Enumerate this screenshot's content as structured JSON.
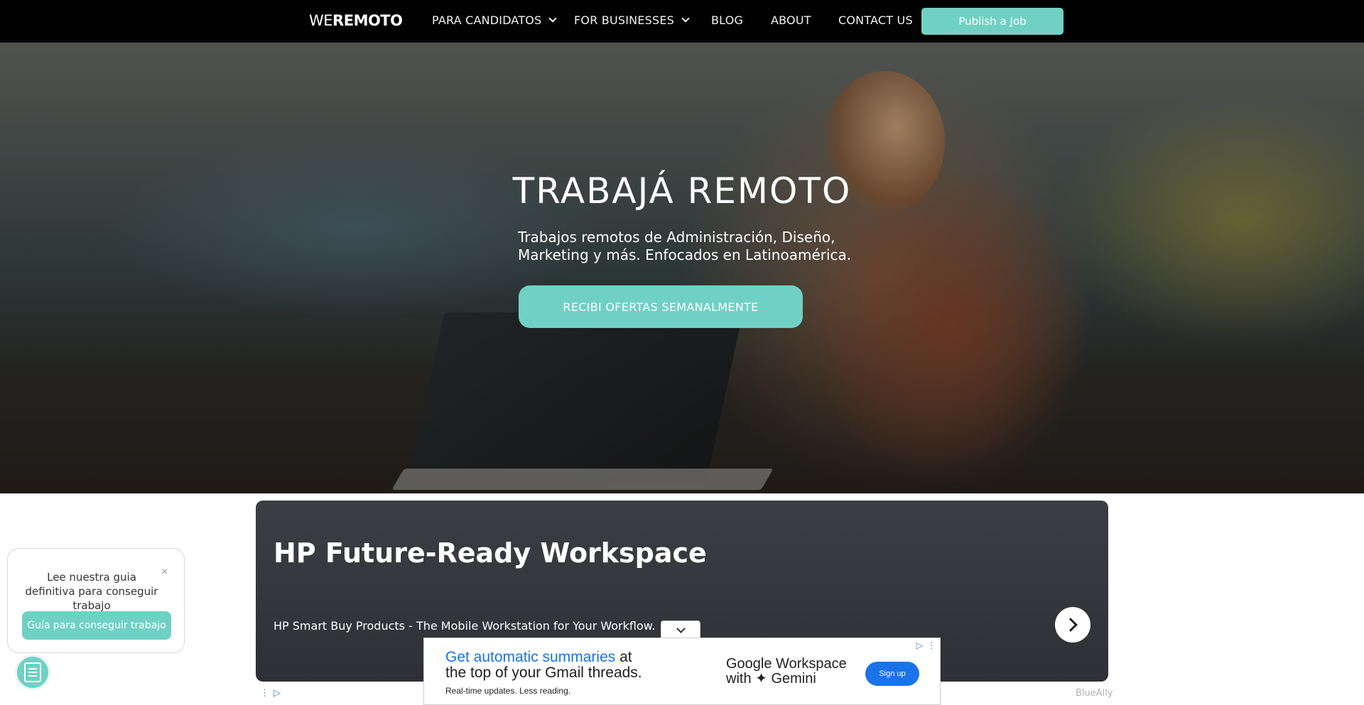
{
  "nav": {
    "logo_light": "WE",
    "logo_bold": "REMOTO",
    "items": [
      {
        "label": "PARA CANDIDATOS",
        "dropdown": true
      },
      {
        "label": "FOR BUSINESSES",
        "dropdown": true
      },
      {
        "label": "BLOG",
        "dropdown": false
      },
      {
        "label": "ABOUT",
        "dropdown": false
      },
      {
        "label": "CONTACT US",
        "dropdown": false
      }
    ],
    "publish_label": "Publish a Job"
  },
  "hero": {
    "title": "TRABAJÁ REMOTO",
    "subtitle": "Trabajos remotos de Administración, Diseño, Marketing y más. Enfocados en Latinoamérica.",
    "cta": "RECIBI OFERTAS SEMANALMENTE"
  },
  "ad": {
    "title": "HP Future-Ready Workspace",
    "description": "HP Smart Buy Products - The Mobile Workstation for Your Workflow.",
    "brand": "BlueAlly",
    "next_icon": "chevron-right-icon"
  },
  "banner": {
    "headline_blue": "Get automatic summaries",
    "headline_rest1": " at",
    "headline_line2": "the top of your ",
    "headline_gmail": "Gmail threads.",
    "small": "Real-time updates. Less reading.",
    "right_line1": "Google Workspace",
    "right_line2": "with ✦ Gemini",
    "button": "Sign up"
  },
  "guide": {
    "text": "Lee nuestra guia definitiva para conseguir trabajo",
    "close": "×",
    "button": "Guía para conseguir trabajo"
  },
  "colors": {
    "accent": "#6fd1c4",
    "nav_bg": "#020202",
    "ad_bg": "#36383d",
    "google_blue": "#1a73e8"
  }
}
